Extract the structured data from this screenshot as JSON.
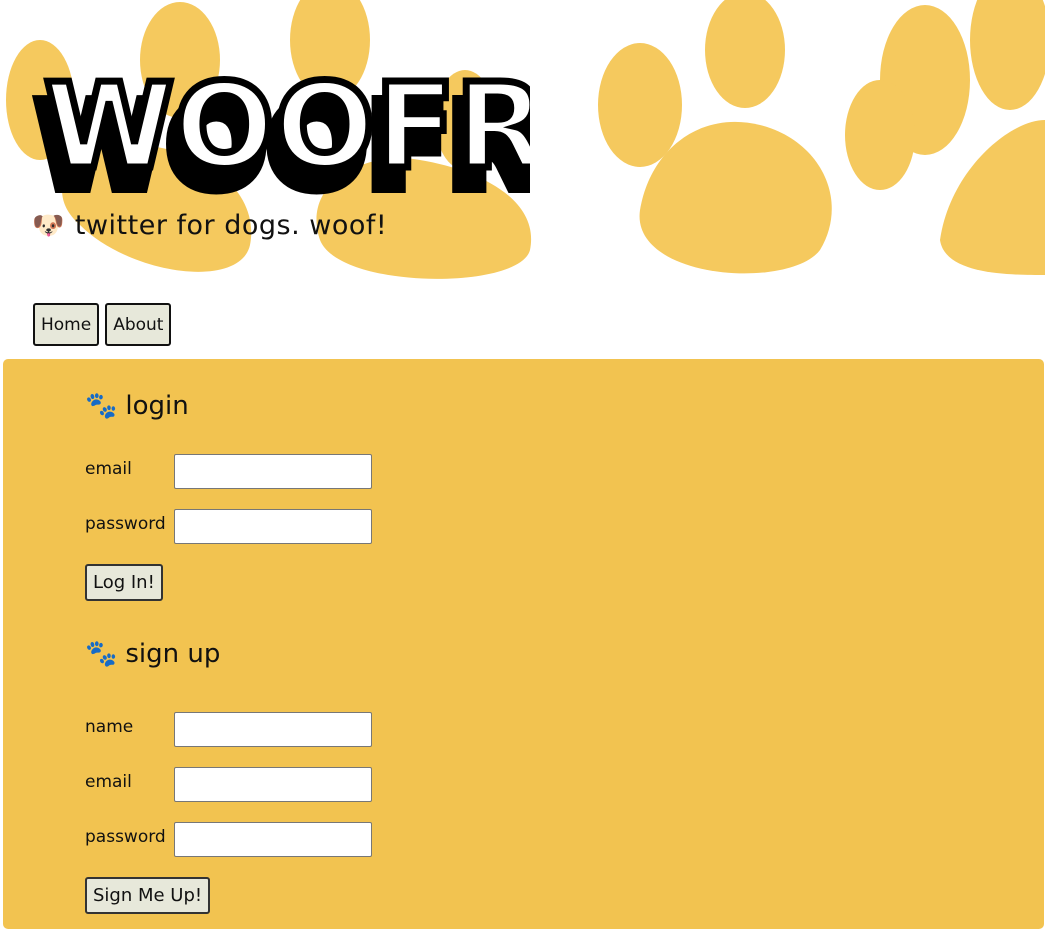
{
  "header": {
    "logo_text": "WOOFR",
    "tagline_icon": "🐶",
    "tagline": "twitter for dogs. woof!"
  },
  "nav": {
    "items": [
      {
        "label": "Home"
      },
      {
        "label": "About"
      }
    ]
  },
  "login": {
    "icon": "🐾",
    "title": "login",
    "fields": [
      {
        "label": "email",
        "value": ""
      },
      {
        "label": "password",
        "value": ""
      }
    ],
    "submit_label": "Log In!"
  },
  "signup": {
    "icon": "🐾",
    "title": "sign up",
    "fields": [
      {
        "label": "name",
        "value": ""
      },
      {
        "label": "email",
        "value": ""
      },
      {
        "label": "password",
        "value": ""
      }
    ],
    "submit_label": "Sign Me Up!"
  },
  "colors": {
    "panel": "#f2c350",
    "paw": "#f5c95e",
    "button": "#e7e8da"
  }
}
